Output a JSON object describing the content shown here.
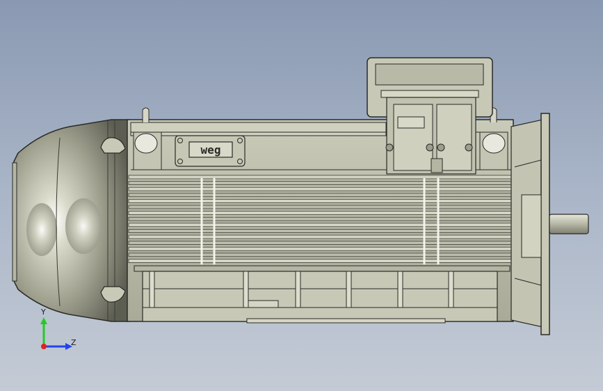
{
  "viewport": {
    "background_top": "#8a99b2",
    "background_bottom": "#c4cbd5"
  },
  "model": {
    "brand_logo_text": "weg",
    "body_color": "#bfc0ae",
    "dark_color": "#2a2a26"
  },
  "triad": {
    "y_label": "Y",
    "z_label": "Z",
    "y_color": "#22cc22",
    "z_color": "#2244ee",
    "x_color": "#dd2222"
  }
}
